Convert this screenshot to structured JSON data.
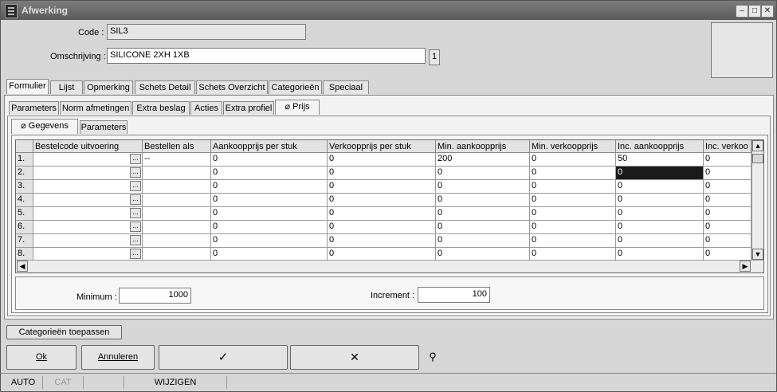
{
  "window": {
    "title": "Afwerking"
  },
  "header": {
    "code_label": "Code :",
    "code_value": "SIL3",
    "omschrijving_label": "Omschrijving :",
    "omschrijving_value": "SILICONE  2XH 1XB",
    "omschrijving_badge": "1"
  },
  "main_tabs": [
    "Formulier",
    "Lijst",
    "Opmerking",
    "Schets Detail",
    "Schets Overzicht",
    "Categorieën",
    "Speciaal"
  ],
  "sub_tabs": [
    "Parameters",
    "Norm afmetingen",
    "Extra beslag",
    "Acties",
    "Extra profiel",
    "Prijs"
  ],
  "inner_tabs": [
    "Gegevens",
    "Parameters"
  ],
  "grid": {
    "columns": [
      "Bestelcode uitvoering",
      "Bestellen als",
      "Aankoopprijs per stuk",
      "Verkoopprijs per stuk",
      "Min. aankoopprijs",
      "Min. verkoopprijs",
      "Inc. aankoopprijs",
      "Inc. verkoo"
    ],
    "rows": [
      {
        "n": "1.",
        "c": [
          "",
          "--",
          "0",
          "0",
          "200",
          "0",
          "50",
          "0"
        ]
      },
      {
        "n": "2.",
        "c": [
          "",
          "",
          "0",
          "0",
          "0",
          "0",
          "0",
          "0"
        ]
      },
      {
        "n": "3.",
        "c": [
          "",
          "",
          "0",
          "0",
          "0",
          "0",
          "0",
          "0"
        ]
      },
      {
        "n": "4.",
        "c": [
          "",
          "",
          "0",
          "0",
          "0",
          "0",
          "0",
          "0"
        ]
      },
      {
        "n": "5.",
        "c": [
          "",
          "",
          "0",
          "0",
          "0",
          "0",
          "0",
          "0"
        ]
      },
      {
        "n": "6.",
        "c": [
          "",
          "",
          "0",
          "0",
          "0",
          "0",
          "0",
          "0"
        ]
      },
      {
        "n": "7.",
        "c": [
          "",
          "",
          "0",
          "0",
          "0",
          "0",
          "0",
          "0"
        ]
      },
      {
        "n": "8.",
        "c": [
          "",
          "",
          "0",
          "0",
          "0",
          "0",
          "0",
          "0"
        ]
      }
    ]
  },
  "footer_fields": {
    "minimum_label": "Minimum :",
    "minimum_value": "1000",
    "increment_label": "Increment :",
    "increment_value": "100"
  },
  "buttons": {
    "categorieen": "Categorieën toepassen",
    "ok": "Ok",
    "annuleren": "Annuleren",
    "check": "✓",
    "cross": "✕",
    "binoculars": "⚲"
  },
  "status": [
    "AUTO",
    "CAT",
    "",
    "WIJZIGEN"
  ]
}
